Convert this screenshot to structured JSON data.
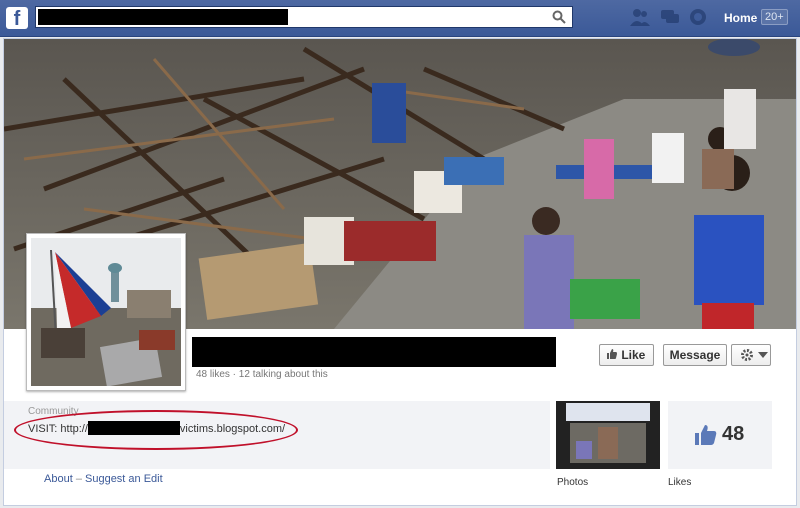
{
  "topbar": {
    "logo": "f",
    "search_icon": "search-icon",
    "home_label": "Home",
    "notification_count": "20+"
  },
  "page": {
    "stats": "48 likes · 12 talking about this",
    "category": "Community",
    "website_prefix": "VISIT: http://",
    "website_suffix": "victims.blogspot.com/"
  },
  "buttons": {
    "like": "Like",
    "message": "Message"
  },
  "links": {
    "about": "About",
    "separator": "–",
    "suggest_edit": "Suggest an Edit"
  },
  "tiles": {
    "photos_label": "Photos",
    "likes_label": "Likes",
    "likes_count": "48"
  },
  "colors": {
    "brand": "#3b5998",
    "highlight_circle": "#c0102a"
  }
}
